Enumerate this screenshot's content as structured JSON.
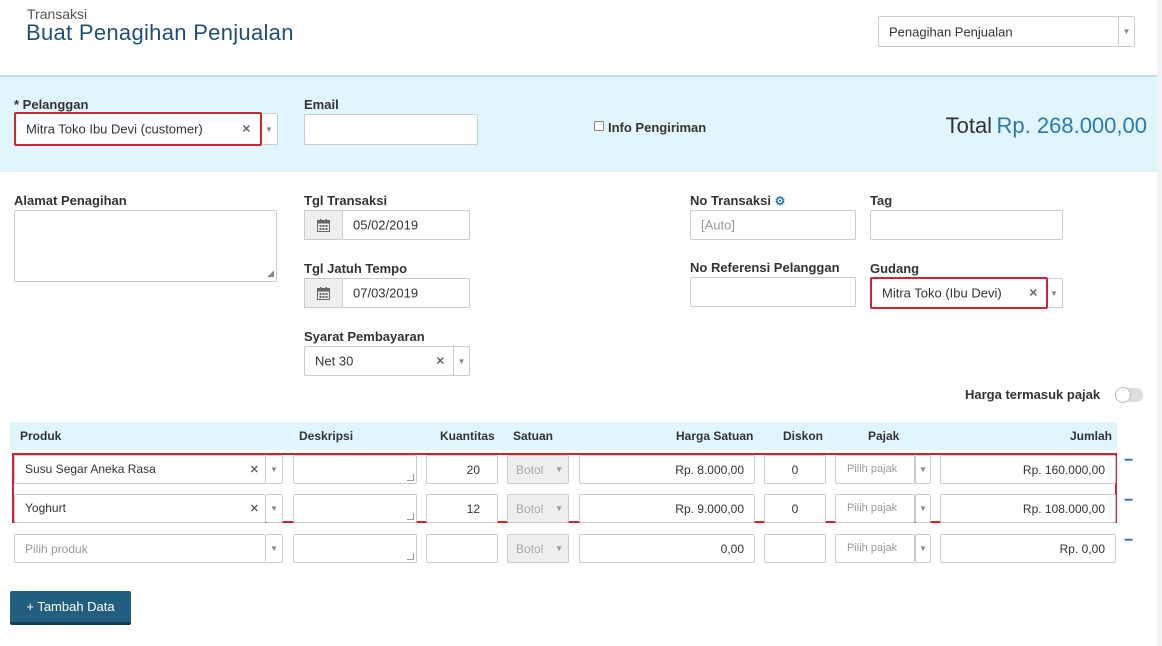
{
  "header": {
    "breadcrumb": "Transaksi",
    "title": "Buat Penagihan Penjualan",
    "type_select": "Penagihan Penjualan"
  },
  "customer": {
    "label": "* Pelanggan",
    "value": "Mitra Toko Ibu Devi (customer)"
  },
  "email": {
    "label": "Email",
    "value": ""
  },
  "shipping_info": {
    "label": "Info Pengiriman",
    "checked": false
  },
  "total": {
    "label": "Total",
    "value": "Rp. 268.000,00"
  },
  "billing_address": {
    "label": "Alamat Penagihan",
    "value": ""
  },
  "transaction_date": {
    "label": "Tgl Transaksi",
    "value": "05/02/2019"
  },
  "due_date": {
    "label": "Tgl Jatuh Tempo",
    "value": "07/03/2019"
  },
  "payment_terms": {
    "label": "Syarat Pembayaran",
    "value": "Net 30"
  },
  "transaction_no": {
    "label": "No Transaksi",
    "placeholder": "[Auto]"
  },
  "customer_ref": {
    "label": "No Referensi Pelanggan",
    "value": ""
  },
  "tag": {
    "label": "Tag",
    "value": ""
  },
  "warehouse": {
    "label": "Gudang",
    "value": "Mitra Toko (Ibu Devi)"
  },
  "tax_inclusive": {
    "label": "Harga termasuk pajak",
    "on": false
  },
  "table": {
    "headers": {
      "product": "Produk",
      "description": "Deskripsi",
      "quantity": "Kuantitas",
      "unit": "Satuan",
      "unit_price": "Harga Satuan",
      "discount": "Diskon",
      "tax": "Pajak",
      "amount": "Jumlah"
    },
    "rows": [
      {
        "product": "Susu Segar Aneka Rasa",
        "description": "",
        "quantity": "20",
        "unit": "Botol",
        "unit_price": "Rp. 8.000,00",
        "discount": "0",
        "tax": "Pilih pajak",
        "amount": "Rp. 160.000,00"
      },
      {
        "product": "Yoghurt",
        "description": "",
        "quantity": "12",
        "unit": "Botol",
        "unit_price": "Rp. 9.000,00",
        "discount": "0",
        "tax": "Pilih pajak",
        "amount": "Rp. 108.000,00"
      },
      {
        "product": "Pilih produk",
        "description": "",
        "quantity": "",
        "unit": "Botol",
        "unit_price": "0,00",
        "discount": "",
        "tax": "Pilih pajak",
        "amount": "Rp. 0,00"
      }
    ]
  },
  "add_button": "+ Tambah Data",
  "colors": {
    "accent": "#2a7ab0",
    "title": "#1f4e79",
    "highlight": "#d0252e",
    "band": "#e1f5fc",
    "button": "#215e7f"
  }
}
